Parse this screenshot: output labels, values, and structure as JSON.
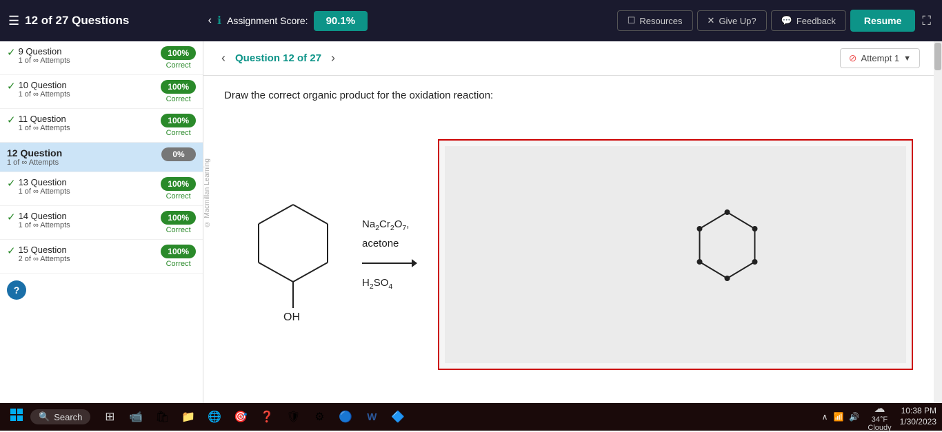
{
  "header": {
    "questions_count": "12 of 27 Questions",
    "assignment_score_label": "Assignment Score:",
    "score_value": "90.1%",
    "resources_label": "Resources",
    "give_up_label": "Give Up?",
    "feedback_label": "Feedback",
    "resume_label": "Resume"
  },
  "sidebar": {
    "items": [
      {
        "id": 9,
        "label": "9 Question",
        "attempts": "1 of ∞ Attempts",
        "score": "100%",
        "status": "Correct",
        "active": false,
        "check": true
      },
      {
        "id": 10,
        "label": "10 Question",
        "attempts": "1 of ∞ Attempts",
        "score": "100%",
        "status": "Correct",
        "active": false,
        "check": true
      },
      {
        "id": 11,
        "label": "11 Question",
        "attempts": "1 of ∞ Attempts",
        "score": "100%",
        "status": "Correct",
        "active": false,
        "check": true
      },
      {
        "id": 12,
        "label": "12 Question",
        "attempts": "1 of ∞ Attempts",
        "score": "0%",
        "status": "",
        "active": true,
        "check": false
      },
      {
        "id": 13,
        "label": "13 Question",
        "attempts": "1 of ∞ Attempts",
        "score": "100%",
        "status": "Correct",
        "active": false,
        "check": true
      },
      {
        "id": 14,
        "label": "14 Question",
        "attempts": "1 of ∞ Attempts",
        "score": "100%",
        "status": "Correct",
        "active": false,
        "check": true
      },
      {
        "id": 15,
        "label": "15 Question",
        "attempts": "2 of ∞ Attempts",
        "score": "100%",
        "status": "Correct",
        "active": false,
        "check": true
      }
    ]
  },
  "question": {
    "number": "Question 12 of 27",
    "attempt_label": "Attempt 1",
    "instruction": "Draw the correct organic product for the oxidation reaction:",
    "copyright": "© Macmillan Learning",
    "reagent1": "Na₂Cr₂O₇,",
    "reagent2": "acetone",
    "reagent3": "H₂SO₄"
  },
  "taskbar": {
    "search_placeholder": "Search",
    "time": "10:38 PM",
    "date": "1/30/2023",
    "weather_temp": "34°F",
    "weather_condition": "Cloudy"
  }
}
